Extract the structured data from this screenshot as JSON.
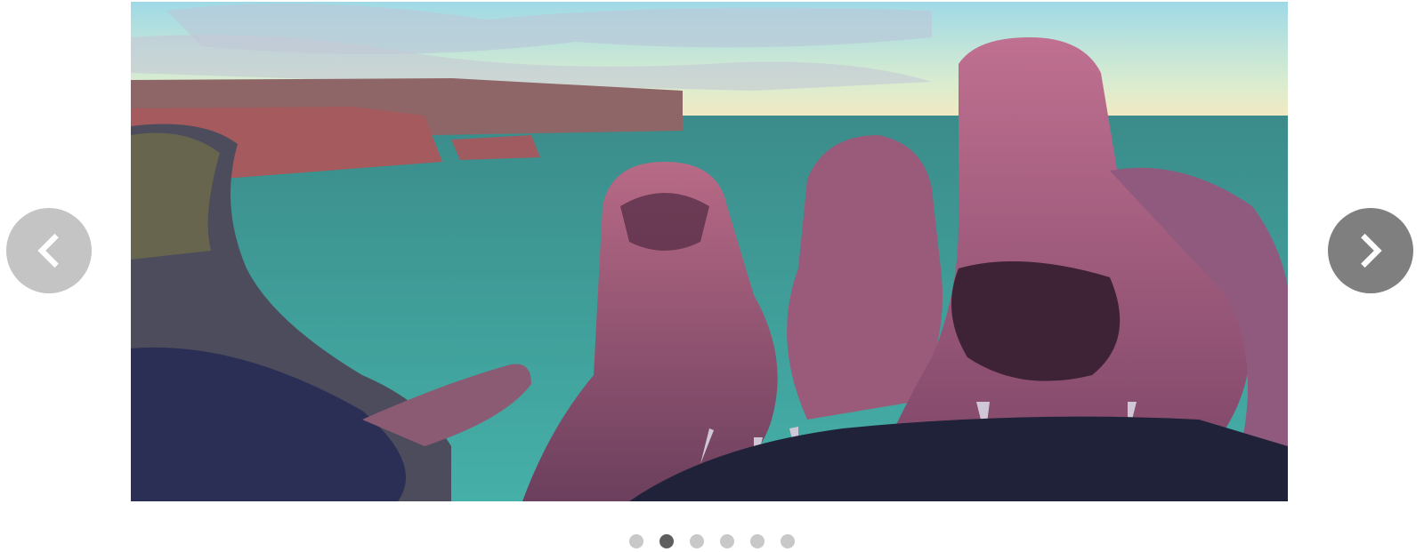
{
  "carousel": {
    "slide_count": 6,
    "active_index": 1,
    "dots": [
      {
        "active": false
      },
      {
        "active": true
      },
      {
        "active": false
      },
      {
        "active": false
      },
      {
        "active": false
      },
      {
        "active": false
      }
    ],
    "prev_icon": "chevron-left-icon",
    "next_icon": "chevron-right-icon"
  },
  "colors": {
    "prev_button": "#c4c4c4",
    "next_button": "#7f7f7f",
    "dot_inactive": "#c8c8c8",
    "dot_active": "#5e5e5e"
  },
  "slide": {
    "illustration": "marine-iguanas-on-coastal-cliff"
  }
}
